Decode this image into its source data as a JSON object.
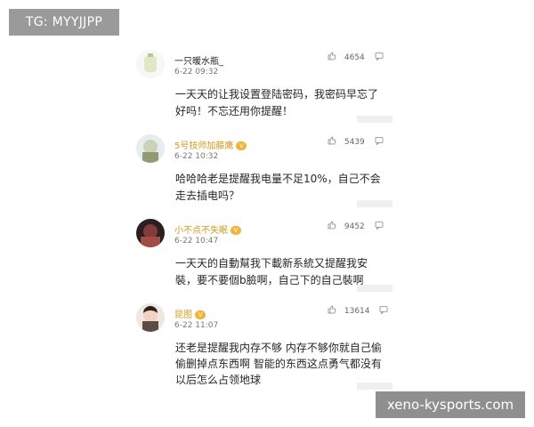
{
  "watermarks": {
    "top_left": "TG: MYYJJPP",
    "bottom_right": "xeno-kysports.com"
  },
  "comments": [
    {
      "name": "一只暖水瓶_",
      "time": "6-22 09:32",
      "likes": "4654",
      "text": "一天天的让我设置登陆密码，我密码早忘了好吗！不忘还用你提醒！",
      "name_color": "#222222"
    },
    {
      "name": "5号技师加藤鹰",
      "time": "6-22 10:32",
      "likes": "5439",
      "text": "哈哈哈老是提醒我电量不足10%，自己不会走去插电吗？",
      "name_color": "#d39b21"
    },
    {
      "name": "小不点不失眠",
      "time": "6-22 10:47",
      "likes": "9452",
      "text": "一天天的自動幫我下載新系統又提醒我安裝，要不要個b臉啊，自己下的自己裝啊",
      "name_color": "#d39b21"
    },
    {
      "name": "昆图",
      "time": "6-22 11:07",
      "likes": "13614",
      "text": "还老是提醒我内存不够 内存不够你就自己偷偷删掉点东西啊 智能的东西这点勇气都没有以后怎么占领地球",
      "name_color": "#d39b21"
    }
  ],
  "icons": {
    "like": "thumbs-up-icon",
    "reply": "reply-icon"
  }
}
